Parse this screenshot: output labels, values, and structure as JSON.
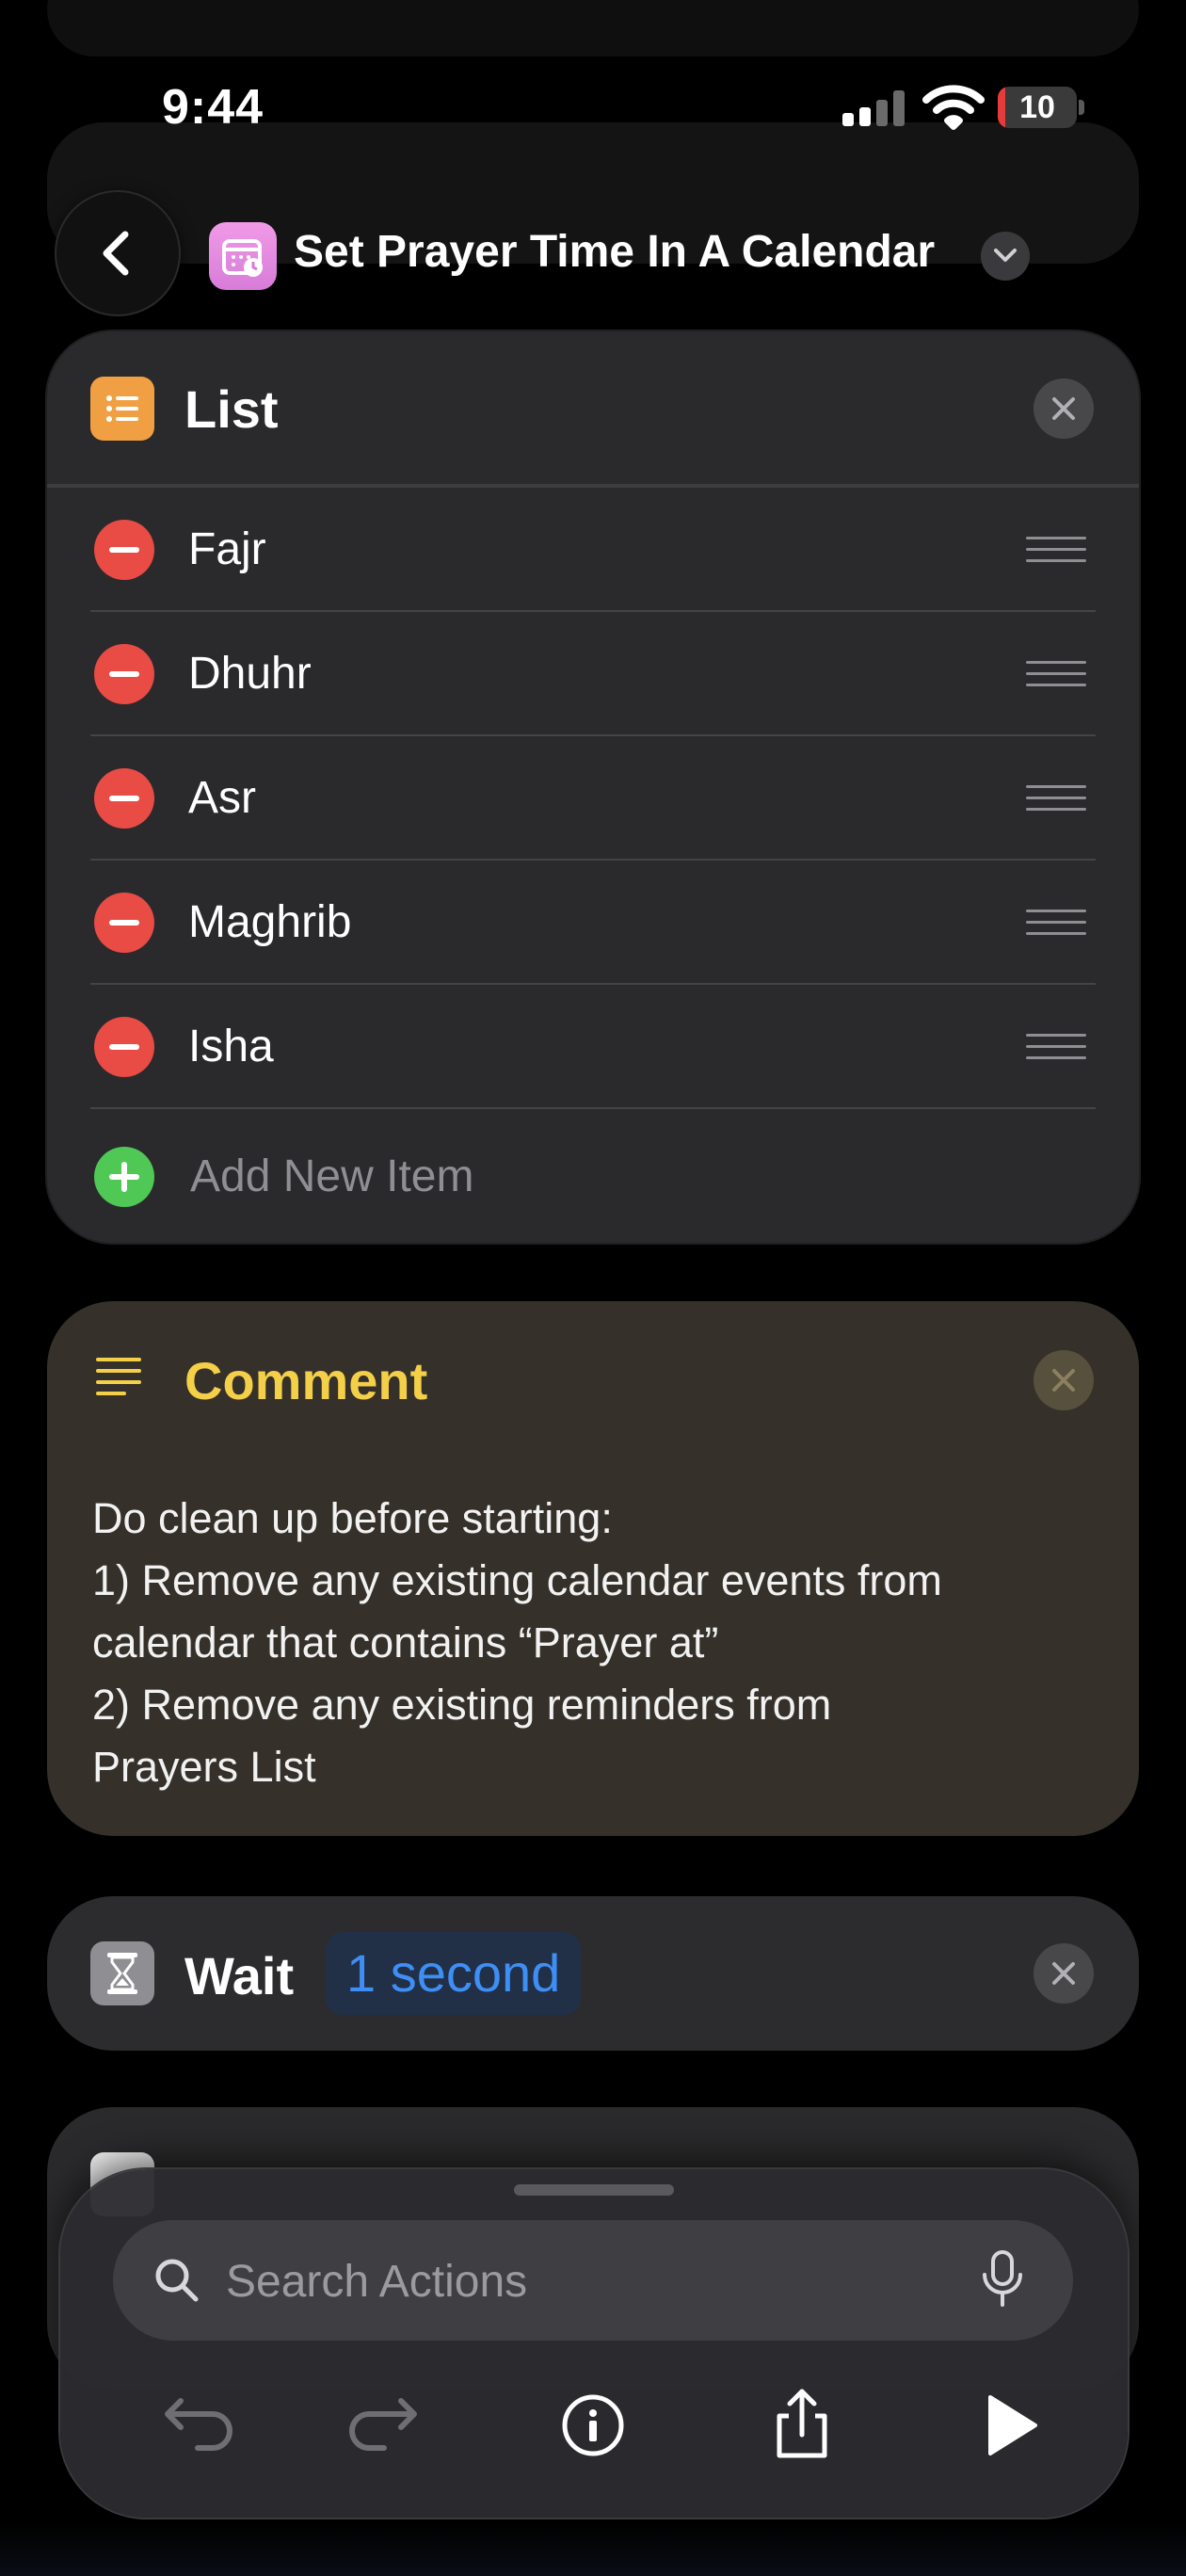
{
  "status_bar": {
    "time": "9:44",
    "battery": "10",
    "battery_level": 0.1
  },
  "header": {
    "title": "Set Prayer Time In A Calendar",
    "app_icon": "calendar-clock-icon"
  },
  "list_action": {
    "title": "List",
    "items": [
      {
        "label": "Fajr"
      },
      {
        "label": "Dhuhr"
      },
      {
        "label": "Asr"
      },
      {
        "label": "Maghrib"
      },
      {
        "label": "Isha"
      }
    ],
    "add_label": "Add New Item"
  },
  "comment_action": {
    "title": "Comment",
    "lines": [
      "Do clean up before starting:",
      "1) Remove any existing calendar events from",
      "calendar that contains “Prayer at”",
      "2) Remove any existing reminders from",
      "Prayers List"
    ]
  },
  "wait_action": {
    "title": "Wait",
    "value": "1 second"
  },
  "toolbar": {
    "search_placeholder": "Search Actions",
    "buttons": [
      "undo-icon",
      "redo-icon",
      "info-icon",
      "share-icon",
      "play-icon"
    ]
  },
  "colors": {
    "list_icon": "#f0a042",
    "comment_title": "#f4cf48",
    "wait_value": "#3e8ff5",
    "remove": "#e94b45",
    "add": "#4fc856"
  }
}
